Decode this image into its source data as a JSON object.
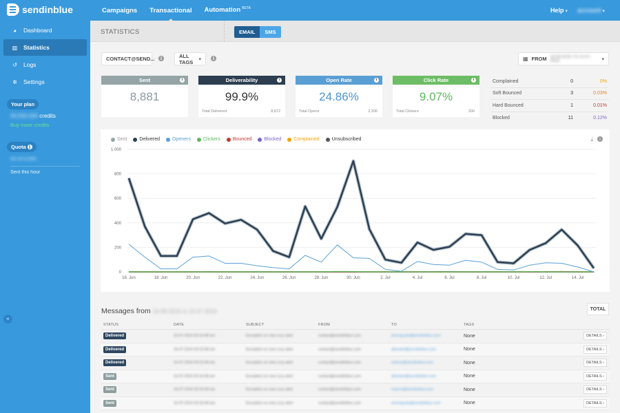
{
  "app": {
    "brand": "sendinblue",
    "topnav": [
      {
        "label": "Campaigns",
        "active": false
      },
      {
        "label": "Transactional",
        "active": true
      },
      {
        "label": "Automation",
        "badge": "BETA",
        "active": false
      }
    ],
    "help_label": "Help",
    "account_label": "account"
  },
  "sidebar": {
    "items": [
      {
        "label": "Dashboard",
        "icon": "dashboard-icon",
        "active": false
      },
      {
        "label": "Statistics",
        "icon": "bar-chart-icon",
        "active": true
      },
      {
        "label": "Logs",
        "icon": "history-icon",
        "active": false
      },
      {
        "label": "Settings",
        "icon": "gear-icon",
        "active": false
      }
    ],
    "plan_label": "Your plan",
    "plan_credits_value": "00,000,000",
    "plan_credits_suffix": "credits",
    "buy_more": "Buy more credits",
    "quota_label": "Quota",
    "quota_value": "00 of 0,000",
    "quota_sub": "Sent this hour"
  },
  "subheader": {
    "title": "STATISTICS",
    "channels": [
      {
        "label": "EMAIL",
        "selected": true
      },
      {
        "label": "SMS",
        "selected": false
      }
    ]
  },
  "filters": {
    "sender": "CONTACT@SEND...",
    "tags": "ALL TAGS",
    "date_prefix": "FROM",
    "date_range": "16-06-2016 TO 15-07-2016"
  },
  "cards": [
    {
      "title": "Sent",
      "value": "8,881",
      "footer_label": "",
      "footer_value": "",
      "color": "#95a5a6",
      "value_color": "#8a9aa0"
    },
    {
      "title": "Deliverability",
      "value": "99.9%",
      "footer_label": "Total Delivered",
      "footer_value": "8,872",
      "color": "#2c3e50",
      "value_color": "#333333"
    },
    {
      "title": "Open Rate",
      "value": "24.86%",
      "footer_label": "Total Opens",
      "footer_value": "2,206",
      "color": "#5a9fd4",
      "value_color": "#4d94d2"
    },
    {
      "title": "Click Rate",
      "value": "9.07%",
      "footer_label": "Total Clickers",
      "footer_value": "200",
      "color": "#6cbd65",
      "value_color": "#5cb85c"
    }
  ],
  "summary": [
    {
      "label": "Complained",
      "count": "0",
      "pct": "0%",
      "color": "#f0a30a"
    },
    {
      "label": "Soft Bounced",
      "count": "3",
      "pct": "0.03%",
      "color": "#e67e22"
    },
    {
      "label": "Hard Bounced",
      "count": "1",
      "pct": "0.01%",
      "color": "#c0392b"
    },
    {
      "label": "Blocked",
      "count": "11",
      "pct": "0.12%",
      "color": "#7a63c8"
    }
  ],
  "chart_data": {
    "type": "line",
    "title": "",
    "xlabel": "",
    "ylabel": "",
    "ylim": [
      0,
      1000
    ],
    "yticks": [
      "0",
      "200",
      "400",
      "600",
      "800",
      "1 000"
    ],
    "ytick_values": [
      0,
      200,
      400,
      600,
      800,
      1000
    ],
    "grid": true,
    "legend_position": "top-left",
    "x": [
      "16. Jun",
      "17. Jun",
      "18. Jun",
      "19. Jun",
      "20. Jun",
      "21. Jun",
      "22. Jun",
      "23. Jun",
      "24. Jun",
      "25. Jun",
      "26. Jun",
      "27. Jun",
      "28. Jun",
      "29. Jun",
      "30. Jun",
      "1. Jul",
      "2. Jul",
      "3. Jul",
      "4. Jul",
      "5. Jul",
      "6. Jul",
      "7. Jul",
      "8. Jul",
      "9. Jul",
      "10. Jul",
      "11. Jul",
      "12. Jul",
      "13. Jul",
      "14. Jul",
      "15. Jul"
    ],
    "xtick_labels": [
      "16. Jun",
      "18. Jun",
      "20. Jun",
      "22. Jun",
      "24. Jun",
      "26. Jun",
      "28. Jun",
      "30. Jun",
      "2. Jul",
      "4. Jul",
      "6. Jul",
      "8. Jul",
      "10. Jul",
      "12. Jul",
      "14. Jul"
    ],
    "series": [
      {
        "name": "Sent",
        "color": "#95a5a6",
        "values": [
          770,
          372,
          132,
          132,
          432,
          482,
          397,
          427,
          347,
          172,
          122,
          538,
          272,
          532,
          910,
          352,
          102,
          77,
          242,
          182,
          207,
          312,
          302,
          82,
          72,
          182,
          237,
          347,
          217,
          32
        ]
      },
      {
        "name": "Delivered",
        "color": "#2c3e50",
        "values": [
          765,
          370,
          130,
          130,
          430,
          480,
          395,
          425,
          345,
          170,
          120,
          535,
          270,
          530,
          905,
          350,
          100,
          75,
          240,
          180,
          205,
          310,
          300,
          80,
          70,
          180,
          235,
          345,
          215,
          30
        ]
      },
      {
        "name": "Openers",
        "color": "#5a9fd4",
        "values": [
          225,
          120,
          25,
          25,
          120,
          130,
          70,
          70,
          50,
          35,
          25,
          135,
          80,
          220,
          115,
          110,
          20,
          5,
          85,
          60,
          55,
          95,
          80,
          20,
          15,
          55,
          75,
          70,
          40,
          0
        ]
      },
      {
        "name": "Clickers",
        "color": "#5cb85c",
        "values": [
          0,
          0,
          0,
          0,
          0,
          0,
          0,
          0,
          0,
          0,
          0,
          0,
          0,
          3,
          2,
          0,
          0,
          0,
          0,
          0,
          0,
          0,
          0,
          0,
          0,
          1,
          0,
          0,
          0,
          0
        ]
      },
      {
        "name": "Bounced",
        "color": "#c0392b",
        "values": [
          0,
          0,
          0,
          0,
          0,
          0,
          0,
          0,
          0,
          0,
          0,
          0,
          0,
          0,
          0,
          0,
          0,
          0,
          0,
          0,
          0,
          0,
          0,
          0,
          0,
          0,
          0,
          2,
          0,
          0
        ]
      },
      {
        "name": "Blocked",
        "color": "#7a63c8",
        "values": [
          0,
          0,
          0,
          0,
          0,
          2,
          0,
          0,
          0,
          0,
          0,
          0,
          0,
          0,
          0,
          0,
          0,
          0,
          0,
          2,
          2,
          0,
          0,
          0,
          0,
          0,
          0,
          0,
          0,
          0
        ]
      },
      {
        "name": "Complained",
        "color": "#f0a30a",
        "values": [
          0,
          0,
          0,
          0,
          0,
          0,
          0,
          0,
          0,
          0,
          0,
          0,
          0,
          0,
          0,
          0,
          0,
          0,
          0,
          0,
          0,
          0,
          0,
          0,
          0,
          0,
          0,
          0,
          0,
          0
        ]
      },
      {
        "name": "Unsubscribed",
        "color": "#555555",
        "values": [
          0,
          0,
          0,
          0,
          0,
          0,
          0,
          0,
          0,
          0,
          0,
          0,
          0,
          0,
          0,
          0,
          0,
          0,
          0,
          0,
          0,
          0,
          0,
          0,
          0,
          0,
          0,
          0,
          0,
          0
        ]
      }
    ]
  },
  "messages": {
    "title_prefix": "Messages from",
    "title_range": "16-06-2016 to 15-07-2016",
    "total_label": "TOTAL",
    "columns": [
      "STATUS",
      "DATE",
      "SUBJECT",
      "FROM",
      "TO",
      "TAGS",
      ""
    ],
    "details_label": "DETAILS ›",
    "rows": [
      {
        "status": "Delivered",
        "date": "15-07-2016 03:16:08 am",
        "subject": "Exception on new cccy alert",
        "from": "contact@sendinblue.com",
        "to": "amongusta@sendinblue.com",
        "tags": "None"
      },
      {
        "status": "Delivered",
        "date": "15-07-2016 03:16:08 am",
        "subject": "Exception on new cccy alert",
        "from": "contact@sendinblue.com",
        "to": "abinsted@sendinblue.com",
        "tags": "None"
      },
      {
        "status": "Delivered",
        "date": "15-07-2016 03:16:08 am",
        "subject": "Exception on new cccy alert",
        "from": "contact@sendinblue.com",
        "to": "mannn@sendinblue.com",
        "tags": "None"
      },
      {
        "status": "Sent",
        "date": "15-07-2016 03:16:08 am",
        "subject": "Exception on new cccy alert",
        "from": "contact@sendinblue.com",
        "to": "abinsted@sendinblue.com",
        "tags": "None"
      },
      {
        "status": "Sent",
        "date": "15-07-2016 03:16:08 am",
        "subject": "Exception on new cccy alert",
        "from": "contact@sendinblue.com",
        "to": "mannn@sendinblue.com",
        "tags": "None"
      },
      {
        "status": "Sent",
        "date": "15-07-2016 03:16:08 am",
        "subject": "Exception on new cccy alert",
        "from": "contact@sendinblue.com",
        "to": "amongusta@sendinblue.com",
        "tags": "None"
      }
    ]
  }
}
